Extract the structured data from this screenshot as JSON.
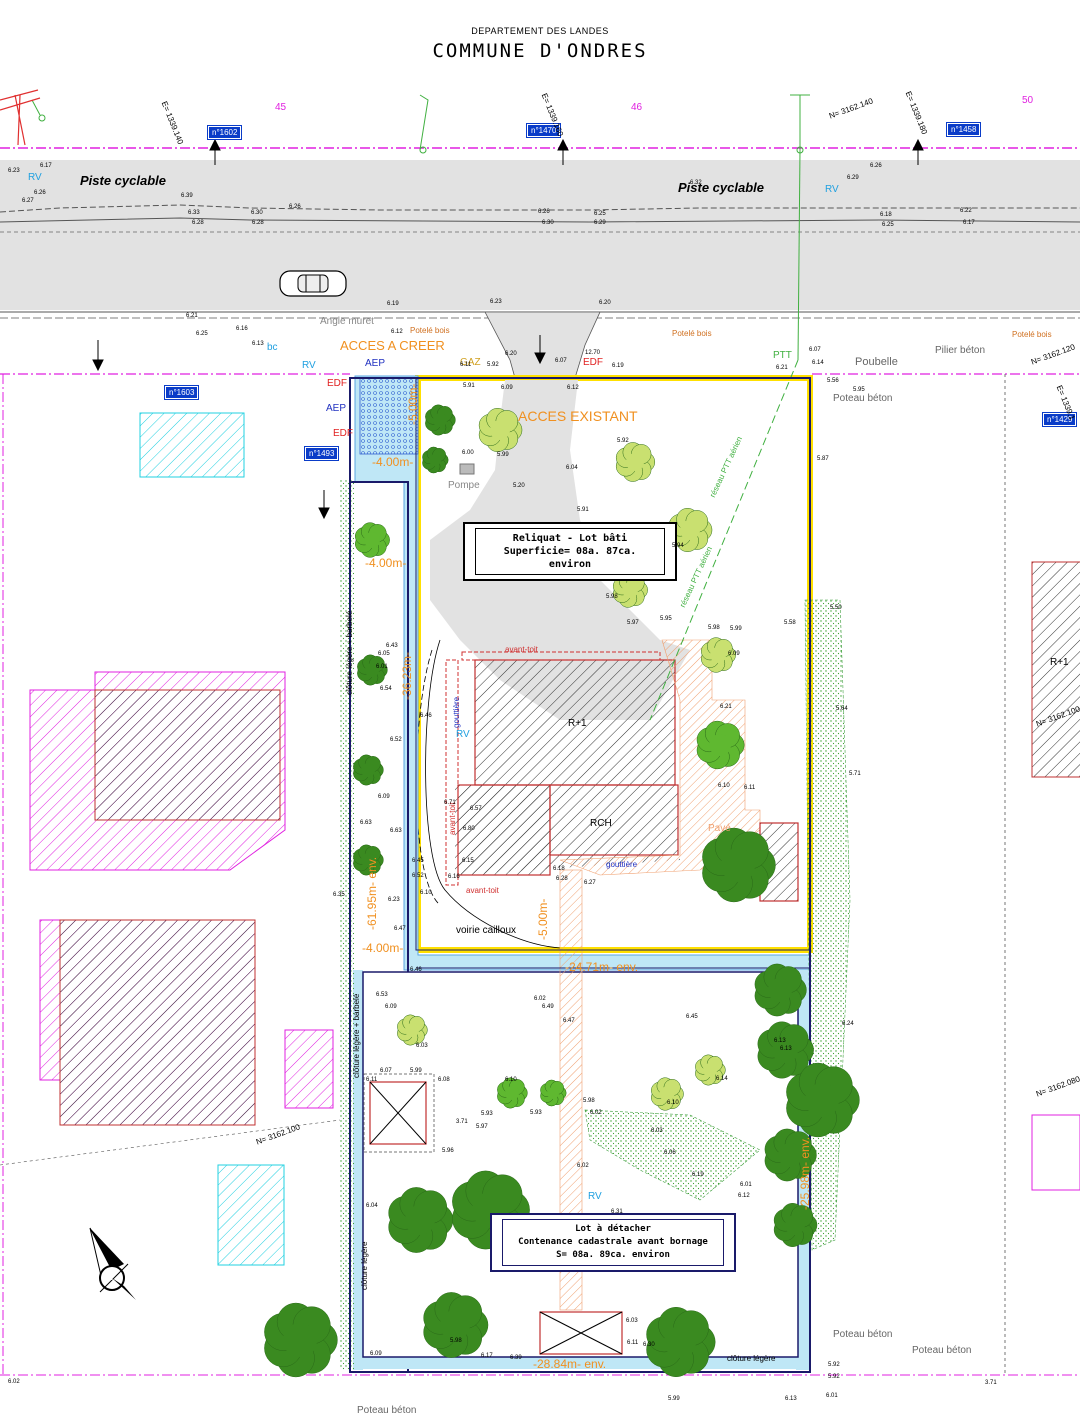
{
  "header": {
    "department": "DEPARTEMENT DES LANDES",
    "commune": "COMMUNE D'ONDRES"
  },
  "road": {
    "label_left": "Piste cyclable",
    "label_right": "Piste cyclable"
  },
  "sections": [
    "45",
    "46",
    "50"
  ],
  "parcels": [
    "n°1602",
    "n°1470",
    "n°1458",
    "n°1603",
    "n°1493",
    "n°1429"
  ],
  "coords": {
    "e1": "E= 1339.140",
    "e2": "E= 1339.160",
    "e3": "E= 1339.180",
    "e4": "E= 1339.1",
    "n1": "N= 3162.140",
    "n2": "N= 3162.120",
    "n3": "N= 3162.100",
    "n4": "N= 3162.100",
    "n5": "N= 3162.080"
  },
  "labels": {
    "acces_creer": "ACCES A CREER",
    "acces_existant": "ACCES EXISTANT",
    "angle_muret": "Angle muret",
    "potelet_bois": "Potelé bois",
    "pilier_beton": "Pilier béton",
    "poteau_beton": "Poteau béton",
    "poubelle": "Poubelle",
    "ptt": "PTT",
    "gaz": "GAZ",
    "edf": "EDF",
    "aep": "AEP",
    "rv": "RV",
    "bc": "bc",
    "pompe": "Pompe",
    "reseau_ptt": "réseau PTT aérien",
    "avant_toit": "avant-toit",
    "gouttiere": "gouttière",
    "r1": "R+1",
    "rch": "RCH",
    "pave": "Pavé",
    "voirie": "voirie cailloux",
    "cloture_barbele": "clôture légère + barbelé",
    "cloture_legere": "clôture légère",
    "north": "N"
  },
  "dimensions": {
    "d1": "-5.00m-",
    "d2": "-4.00m-",
    "d3": "-36.23m-",
    "d4": "-61.95m- env.",
    "d5": "-4.00m-",
    "d6": "-5.00m-",
    "d7": "-24.71m- env.",
    "d8": "-25.98m- env.",
    "d9": "-28.84m- env.",
    "d10": "-4.00m-"
  },
  "lots": {
    "reliquat_title": "Reliquat - Lot bâti",
    "reliquat_area": "Superficie= 08a. 87ca. environ",
    "detacher_title": "Lot à détacher",
    "detacher_line2": "Contenance cadastrale avant bornage",
    "detacher_area": "S= 08a. 89ca. environ"
  },
  "spot_heights": [
    "6.23",
    "6.26",
    "6.27",
    "6.17",
    "6.39",
    "6.33",
    "6.28",
    "6.30",
    "6.26",
    "6.28",
    "6.26",
    "6.30",
    "6.25",
    "6.29",
    "6.32",
    "6.29",
    "6.18",
    "6.25",
    "6.26",
    "6.22",
    "6.17",
    "6.21",
    "6.25",
    "6.16",
    "6.23",
    "6.20",
    "6.20",
    "6.19",
    "6.12",
    "6.13",
    "6.11",
    "5.91",
    "5.92",
    "6.09",
    "6.07",
    "6.12",
    "12.70",
    "6.19",
    "6.21",
    "6.07",
    "6.14",
    "5.56",
    "5.95",
    "5.87",
    "5.92",
    "5.99",
    "6.00",
    "6.04",
    "5.20",
    "5.91",
    "5.94",
    "5.98",
    "5.97",
    "5.95",
    "5.98",
    "5.99",
    "6.09",
    "5.58",
    "5.50",
    "5.64",
    "5.71",
    "6.43",
    "6.05",
    "6.01",
    "6.54",
    "6.46",
    "6.52",
    "6.09",
    "6.63",
    "6.63",
    "6.35",
    "6.23",
    "6.47",
    "6.45",
    "6.52",
    "6.10",
    "6.46",
    "6.53",
    "6.09",
    "6.02",
    "6.49",
    "6.47",
    "6.45",
    "6.24",
    "6.13",
    "6.13",
    "6.14",
    "6.10",
    "6.03",
    "6.07",
    "5.99",
    "6.08",
    "6.11",
    "5.96",
    "6.10",
    "5.93",
    "5.97",
    "5.93",
    "5.98",
    "6.02",
    "6.03",
    "6.06",
    "6.02",
    "6.19",
    "6.12",
    "6.01",
    "6.31",
    "6.04",
    "5.98",
    "6.03",
    "6.11",
    "6.30",
    "6.39",
    "6.17",
    "6.09",
    "5.92",
    "5.92",
    "6.01",
    "5.99",
    "6.13",
    "6.02",
    "3.71",
    "3.71",
    "6.71",
    "6.57",
    "6.80",
    "6.15",
    "6.27",
    "6.28",
    "6.18",
    "6.16",
    "6.10",
    "6.11",
    "6.21",
    "6.23",
    "6.12"
  ]
}
